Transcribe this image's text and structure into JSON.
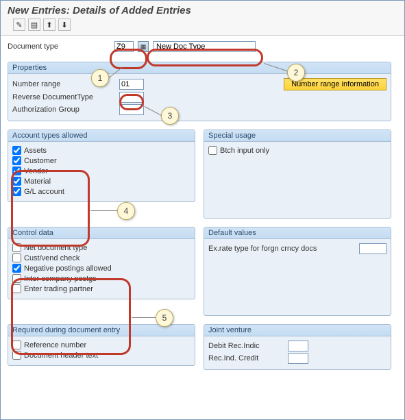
{
  "title": "New Entries: Details of Added Entries",
  "toolbar_icons": {
    "a": "✎",
    "b": "▤",
    "c": "⬆",
    "d": "⬇"
  },
  "doc_type": {
    "label": "Document type",
    "code_value": "Z9",
    "desc_value": "New Doc Type"
  },
  "properties": {
    "title": "Properties",
    "number_range": {
      "label": "Number range",
      "value": "01"
    },
    "reverse_doc": {
      "label": "Reverse DocumentType",
      "value": ""
    },
    "auth_group": {
      "label": "Authorization Group",
      "value": ""
    },
    "num_range_info_btn": "Number range information"
  },
  "account_types": {
    "title": "Account types allowed",
    "items": [
      {
        "label": "Assets",
        "checked": true
      },
      {
        "label": "Customer",
        "checked": true
      },
      {
        "label": "Vendor",
        "checked": true
      },
      {
        "label": "Material",
        "checked": true
      },
      {
        "label": "G/L account",
        "checked": true
      }
    ]
  },
  "special_usage": {
    "title": "Special usage",
    "items": [
      {
        "label": "Btch input only",
        "checked": false
      }
    ]
  },
  "control_data": {
    "title": "Control data",
    "items": [
      {
        "label": "Net document type",
        "checked": false
      },
      {
        "label": "Cust/vend check",
        "checked": false
      },
      {
        "label": "Negative postings allowed",
        "checked": true
      },
      {
        "label": "Inter-company postgs",
        "checked": false
      },
      {
        "label": "Enter trading partner",
        "checked": false
      }
    ]
  },
  "default_values": {
    "title": "Default values",
    "ex_rate": {
      "label": "Ex.rate type for forgn crncy docs",
      "value": ""
    }
  },
  "required_entry": {
    "title": "Required during document entry",
    "items": [
      {
        "label": "Reference number",
        "checked": false
      },
      {
        "label": "Document header text",
        "checked": false
      }
    ]
  },
  "joint_venture": {
    "title": "Joint venture",
    "debit": {
      "label": "Debit Rec.Indic",
      "value": ""
    },
    "credit": {
      "label": "Rec.Ind. Credit",
      "value": ""
    }
  },
  "callouts": {
    "c1": "1",
    "c2": "2",
    "c3": "3",
    "c4": "4",
    "c5": "5"
  }
}
